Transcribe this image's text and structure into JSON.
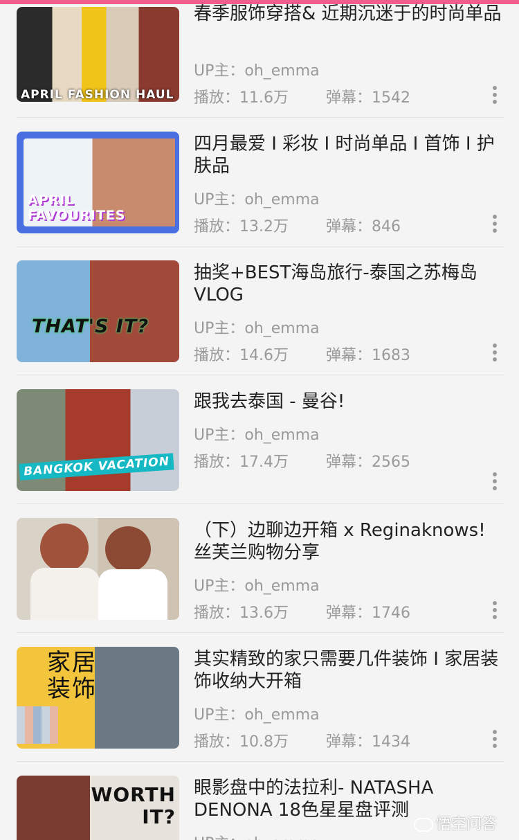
{
  "colors": {
    "accent": "#f25d8e",
    "meta_text": "#9a9a9a",
    "title_text": "#222222"
  },
  "videos": [
    {
      "title": "春季服饰穿搭& 近期沉迷于的时尚单品",
      "uploader": "UP主：oh_emma",
      "plays": "播放：11.6万",
      "danmaku": "弹幕：1542",
      "thumb_text": "APRIL FASHION HAUL"
    },
    {
      "title": "四月最爱 I 彩妆 I 时尚单品 I 首饰 I 护肤品",
      "uploader": "UP主：oh_emma",
      "plays": "播放：13.2万",
      "danmaku": "弹幕：846",
      "thumb_text": "APRIL FAVOURITES"
    },
    {
      "title": "抽奖+BEST海岛旅行-泰国之苏梅岛VLOG",
      "uploader": "UP主：oh_emma",
      "plays": "播放：14.6万",
      "danmaku": "弹幕：1683",
      "thumb_text": "THAT'S IT?"
    },
    {
      "title": "跟我去泰国 - 曼谷!",
      "uploader": "UP主：oh_emma",
      "plays": "播放：17.4万",
      "danmaku": "弹幕：2565",
      "thumb_text": "BANGKOK VACATION"
    },
    {
      "title": "（下）边聊边开箱  x Reginaknows! 丝芙兰购物分享",
      "uploader": "UP主：oh_emma",
      "plays": "播放：13.6万",
      "danmaku": "弹幕：1746",
      "thumb_text": ""
    },
    {
      "title": "其实精致的家只需要几件装饰 I 家居装饰收纳大开箱",
      "uploader": "UP主：oh_emma",
      "plays": "播放：10.8万",
      "danmaku": "弹幕：1434",
      "thumb_text": "家居装饰"
    },
    {
      "title": "眼影盘中的法拉利- NATASHA DENONA 18色星星盘评测",
      "uploader": "UP主：oh_emma",
      "plays": "",
      "danmaku": "",
      "thumb_text": "WORTH IT?"
    }
  ],
  "watermark": "悟空问答"
}
